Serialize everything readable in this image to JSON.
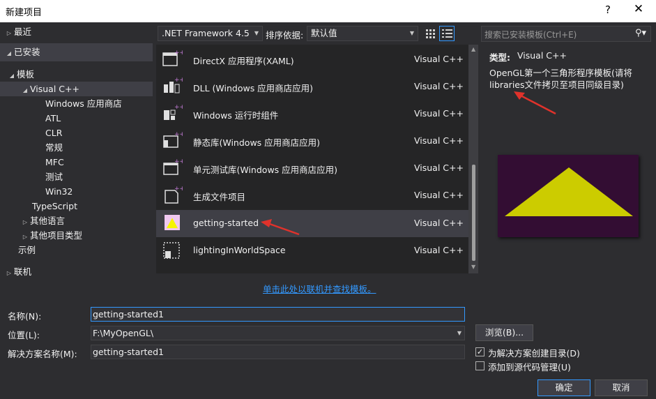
{
  "window": {
    "title": "新建项目",
    "help": "?",
    "close": "✕"
  },
  "tree": {
    "recent": "最近",
    "installed": "已安装",
    "templates": "模板",
    "visual_cpp": "Visual C++",
    "children": [
      "Windows 应用商店",
      "ATL",
      "CLR",
      "常规",
      "MFC",
      "测试",
      "Win32"
    ],
    "typescript": "TypeScript",
    "other_langs": "其他语言",
    "other_types": "其他项目类型",
    "samples": "示例",
    "online": "联机"
  },
  "toolbar": {
    "framework": ".NET Framework 4.5",
    "sort_label": "排序依据:",
    "sort_value": "默认值"
  },
  "templates": [
    {
      "name": "DirectX 应用程序(XAML)",
      "lang": "Visual C++",
      "icon": "directx-app-icon"
    },
    {
      "name": "DLL (Windows 应用商店应用)",
      "lang": "Visual C++",
      "icon": "dll-icon"
    },
    {
      "name": "Windows 运行时组件",
      "lang": "Visual C++",
      "icon": "runtime-component-icon"
    },
    {
      "name": "静态库(Windows 应用商店应用)",
      "lang": "Visual C++",
      "icon": "static-lib-icon"
    },
    {
      "name": "单元测试库(Windows 应用商店应用)",
      "lang": "Visual C++",
      "icon": "unit-test-icon"
    },
    {
      "name": "生成文件项目",
      "lang": "Visual C++",
      "icon": "makefile-icon"
    },
    {
      "name": "getting-started",
      "lang": "Visual C++",
      "icon": "triangle-thumb-icon"
    },
    {
      "name": "lightingInWorldSpace",
      "lang": "Visual C++",
      "icon": "lighting-icon"
    }
  ],
  "online_link": "单击此处以联机并查找模板。",
  "search": {
    "placeholder": "搜索已安装模板(Ctrl+E)"
  },
  "details": {
    "type_label": "类型:",
    "type_value": "Visual C++",
    "description": "OpenGL第一个三角形程序模板(请将libraries文件拷贝至项目同级目录)"
  },
  "form": {
    "name_label": "名称(N):",
    "name_value": "getting-started1",
    "location_label": "位置(L):",
    "location_value": "F:\\MyOpenGL\\",
    "solution_label": "解决方案名称(M):",
    "solution_value": "getting-started1",
    "browse": "浏览(B)...",
    "create_dir": "为解决方案创建目录(D)",
    "create_dir_checked": true,
    "add_source_control": "添加到源代码管理(U)",
    "add_source_control_checked": false,
    "ok": "确定",
    "cancel": "取消"
  },
  "colors": {
    "background": "#2d2d30",
    "accent": "#3399ff",
    "preview_bg": "#330d33",
    "triangle": "#cccc00",
    "annotation_arrow": "#e0322b"
  }
}
